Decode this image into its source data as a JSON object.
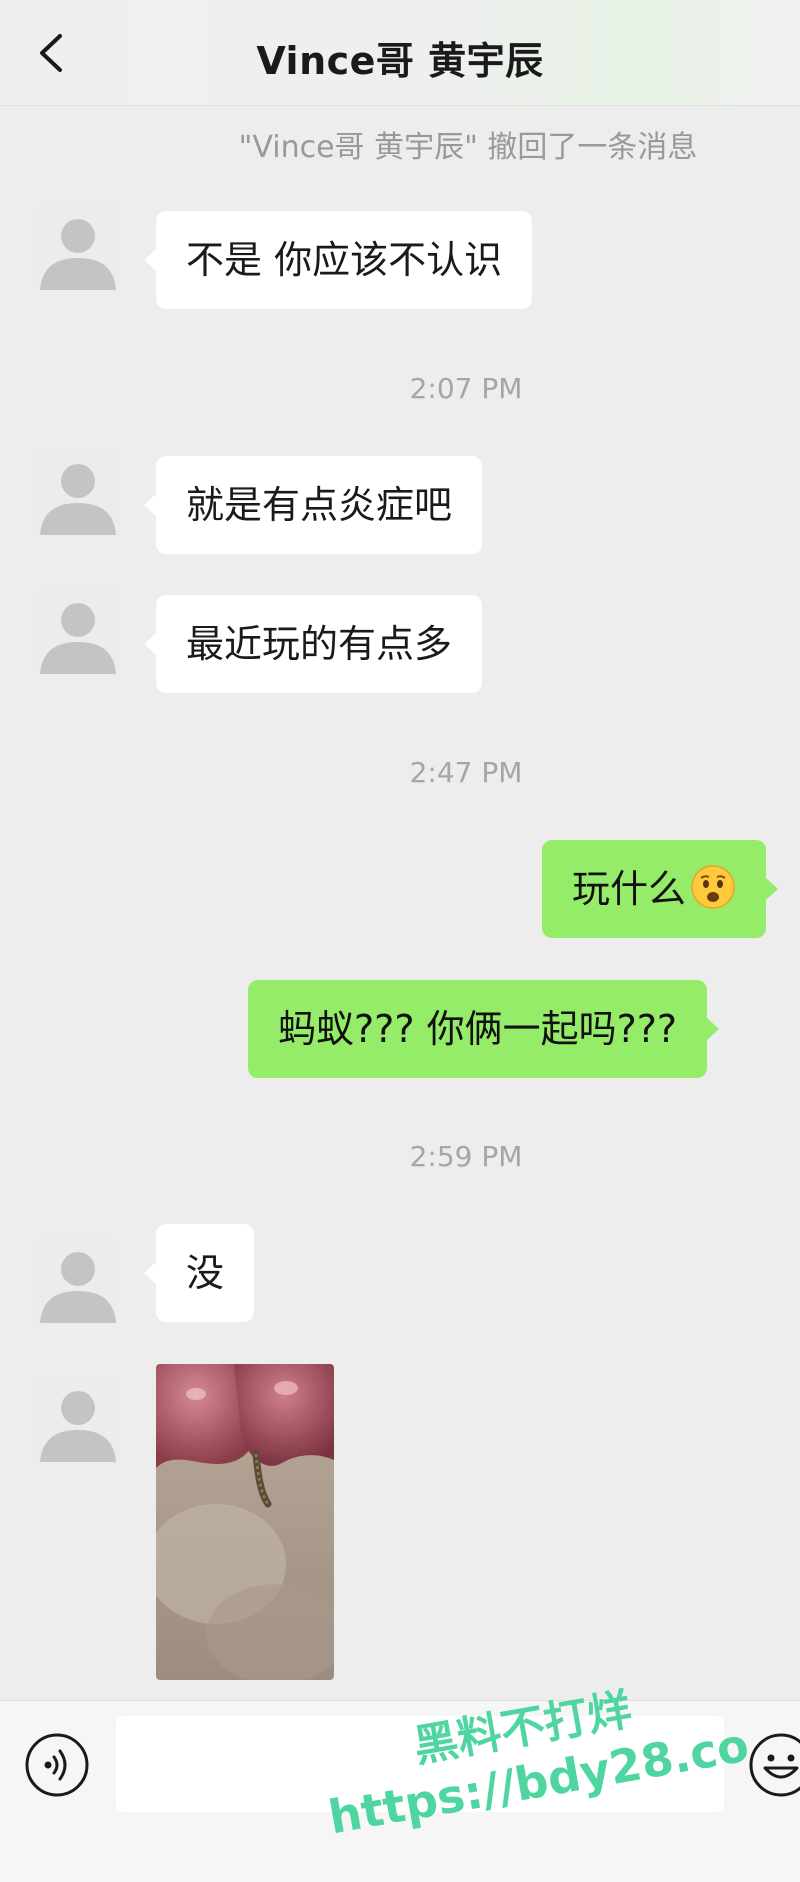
{
  "header": {
    "title": "Vince哥 黄宇辰",
    "back_icon": "chevron-left-icon"
  },
  "system_note": "\"Vince哥 黄宇辰\" 撤回了一条消息",
  "messages": [
    {
      "side": "left",
      "text": "不是 你应该不认识"
    },
    {
      "time": "2:07 PM"
    },
    {
      "side": "left",
      "text": "就是有点炎症吧"
    },
    {
      "side": "left",
      "text": "最近玩的有点多"
    },
    {
      "time": "2:47 PM"
    },
    {
      "side": "right",
      "text": "玩什么",
      "emoji": "astonished-face-emoji"
    },
    {
      "side": "right",
      "text": "蚂蚁??? 你俩一起吗???"
    },
    {
      "time": "2:59 PM"
    },
    {
      "side": "left",
      "text": "没"
    },
    {
      "side": "left",
      "image": "photo-message"
    }
  ],
  "input_bar": {
    "voice_icon": "voice-icon",
    "input_value": "",
    "emoji_icon": "emoji-icon"
  },
  "watermark": {
    "line1": "黑料不打烊",
    "line2": "https://bdy28.co"
  },
  "colors": {
    "background": "#ededed",
    "bubble_left": "#ffffff",
    "bubble_right": "#95ec69",
    "watermark": "#4fd6a0"
  }
}
